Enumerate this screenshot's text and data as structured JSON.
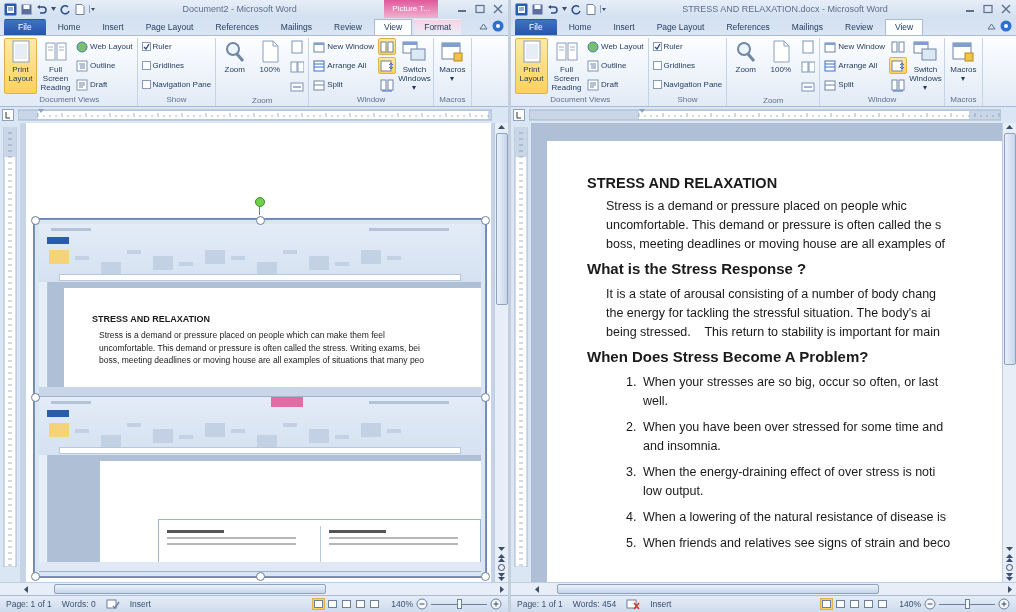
{
  "windows": [
    {
      "title": "Document2 - Microsoft Word",
      "contextual_tab": {
        "label": "Picture T..."
      },
      "tabs": [
        {
          "label": "File",
          "kind": "file",
          "selected": false
        },
        {
          "label": "Home",
          "kind": "normal",
          "selected": false
        },
        {
          "label": "Insert",
          "kind": "normal",
          "selected": false
        },
        {
          "label": "Page Layout",
          "kind": "normal",
          "selected": false
        },
        {
          "label": "References",
          "kind": "normal",
          "selected": false
        },
        {
          "label": "Mailings",
          "kind": "normal",
          "selected": false
        },
        {
          "label": "Review",
          "kind": "normal",
          "selected": false
        },
        {
          "label": "View",
          "kind": "normal",
          "selected": true
        },
        {
          "label": "Format",
          "kind": "contextual",
          "selected": false
        }
      ],
      "ribbon": {
        "groups": [
          {
            "label": "Document Views",
            "items": [
              {
                "kind": "large",
                "label": "Print Layout",
                "selected": true
              },
              {
                "kind": "large",
                "label": "Full Screen Reading",
                "selected": false
              },
              {
                "kind": "small",
                "label": "Web Layout"
              },
              {
                "kind": "small",
                "label": "Outline"
              },
              {
                "kind": "small",
                "label": "Draft"
              }
            ]
          },
          {
            "label": "Show",
            "items": [
              {
                "kind": "check",
                "label": "Ruler",
                "checked": true
              },
              {
                "kind": "check",
                "label": "Gridlines",
                "checked": false
              },
              {
                "kind": "check",
                "label": "Navigation Pane",
                "checked": false
              }
            ]
          },
          {
            "label": "Zoom",
            "items": [
              {
                "kind": "large",
                "label": "Zoom"
              },
              {
                "kind": "large",
                "label": "100%"
              },
              {
                "kind": "icon"
              },
              {
                "kind": "icon"
              },
              {
                "kind": "icon"
              }
            ]
          },
          {
            "label": "Window",
            "items": [
              {
                "kind": "small",
                "label": "New Window"
              },
              {
                "kind": "small",
                "label": "Arrange All"
              },
              {
                "kind": "small",
                "label": "Split"
              },
              {
                "kind": "toggle",
                "on": true
              },
              {
                "kind": "toggle",
                "on": true
              },
              {
                "kind": "toggle",
                "on": false
              },
              {
                "kind": "large",
                "label": "Switch Windows ▾"
              }
            ]
          },
          {
            "label": "Macros",
            "items": [
              {
                "kind": "large",
                "label": "Macros ▾"
              }
            ]
          }
        ]
      },
      "document": {
        "kind": "picture",
        "picture": {
          "selected": true,
          "screens": [
            {
              "kind": "text_page",
              "heading": "STRESS AND RELAXATION",
              "lines": [
                "Stress is a demand or pressure placed on people which can make them feel",
                "uncomfortable. This demand or pressure is often called the stress. Writing exams, bei",
                "boss, meeting deadlines or moving house are all examples of situations that many peo"
              ]
            },
            {
              "kind": "picture_page"
            }
          ]
        }
      },
      "status": {
        "page": "Page: 1 of 1",
        "words": "Words: 0",
        "proofing_errors": false,
        "mode": "Insert",
        "view_buttons": [
          {
            "selected": true
          },
          {
            "selected": false
          },
          {
            "selected": false
          },
          {
            "selected": false
          },
          {
            "selected": false
          }
        ],
        "zoom": "140%",
        "zoom_slider": {
          "level": 0.5
        }
      }
    },
    {
      "title": "STRESS AND RELAXATION.docx - Microsoft Word",
      "tabs": [
        {
          "label": "File",
          "kind": "file",
          "selected": false
        },
        {
          "label": "Home",
          "kind": "normal",
          "selected": false
        },
        {
          "label": "Insert",
          "kind": "normal",
          "selected": false
        },
        {
          "label": "Page Layout",
          "kind": "normal",
          "selected": false
        },
        {
          "label": "References",
          "kind": "normal",
          "selected": false
        },
        {
          "label": "Mailings",
          "kind": "normal",
          "selected": false
        },
        {
          "label": "Review",
          "kind": "normal",
          "selected": false
        },
        {
          "label": "View",
          "kind": "normal",
          "selected": true
        }
      ],
      "ribbon": {
        "groups": [
          {
            "label": "Document Views",
            "items": [
              {
                "kind": "large",
                "label": "Print Layout",
                "selected": true
              },
              {
                "kind": "large",
                "label": "Full Screen Reading",
                "selected": false
              },
              {
                "kind": "small",
                "label": "Web Layout"
              },
              {
                "kind": "small",
                "label": "Outline"
              },
              {
                "kind": "small",
                "label": "Draft"
              }
            ]
          },
          {
            "label": "Show",
            "items": [
              {
                "kind": "check",
                "label": "Ruler",
                "checked": true
              },
              {
                "kind": "check",
                "label": "Gridlines",
                "checked": false
              },
              {
                "kind": "check",
                "label": "Navigation Pane",
                "checked": false
              }
            ]
          },
          {
            "label": "Zoom",
            "items": [
              {
                "kind": "large",
                "label": "Zoom"
              },
              {
                "kind": "large",
                "label": "100%"
              },
              {
                "kind": "icon"
              },
              {
                "kind": "icon"
              },
              {
                "kind": "icon"
              }
            ]
          },
          {
            "label": "Window",
            "items": [
              {
                "kind": "small",
                "label": "New Window"
              },
              {
                "kind": "small",
                "label": "Arrange All"
              },
              {
                "kind": "small",
                "label": "Split"
              },
              {
                "kind": "toggle",
                "on": false
              },
              {
                "kind": "toggle",
                "on": true
              },
              {
                "kind": "toggle",
                "on": false
              },
              {
                "kind": "large",
                "label": "Switch Windows ▾"
              }
            ]
          },
          {
            "label": "Macros",
            "items": [
              {
                "kind": "large",
                "label": "Macros ▾"
              }
            ]
          }
        ]
      },
      "document": {
        "kind": "text",
        "blocks": [
          {
            "kind": "title",
            "text": "STRESS AND RELAXATION"
          },
          {
            "kind": "paragraph",
            "lines": [
              "Stress is a demand or pressure placed on people whic",
              "uncomfortable. This demand or pressure is often called the s",
              "boss, meeting deadlines or moving house are all examples of"
            ]
          },
          {
            "kind": "heading",
            "text": "What is the Stress Response ?"
          },
          {
            "kind": "paragraph",
            "lines": [
              "It is a state of arousal consisting of a number of body chang",
              "the energy for tackling the stressful situation. The body's ai",
              "being stressed.    This return to stability is important for main"
            ]
          },
          {
            "kind": "heading",
            "text": "When Does Stress Become A Problem?"
          },
          {
            "kind": "list",
            "items": [
              {
                "number": "1.",
                "lines": [
                  "When your stresses are so big, occur so often, or last",
                  "well."
                ]
              },
              {
                "number": "2.",
                "lines": [
                  "When you have been over stressed for some time and",
                  "and insomnia."
                ]
              },
              {
                "number": "3.",
                "lines": [
                  "When the energy-draining effect of over stress is noti",
                  "low output."
                ]
              },
              {
                "number": "4.",
                "lines": [
                  "When a lowering of the natural resistance of disease is"
                ]
              },
              {
                "number": "5.",
                "lines": [
                  "When friends and relatives see signs of strain and beco"
                ]
              }
            ]
          }
        ]
      },
      "status": {
        "page": "Page: 1 of 1",
        "words": "Words: 454",
        "proofing_errors": true,
        "mode": "Insert",
        "view_buttons": [
          {
            "selected": true
          },
          {
            "selected": false
          },
          {
            "selected": false
          },
          {
            "selected": false
          },
          {
            "selected": false
          }
        ],
        "zoom": "140%",
        "zoom_slider": {
          "level": 0.5
        }
      }
    }
  ]
}
